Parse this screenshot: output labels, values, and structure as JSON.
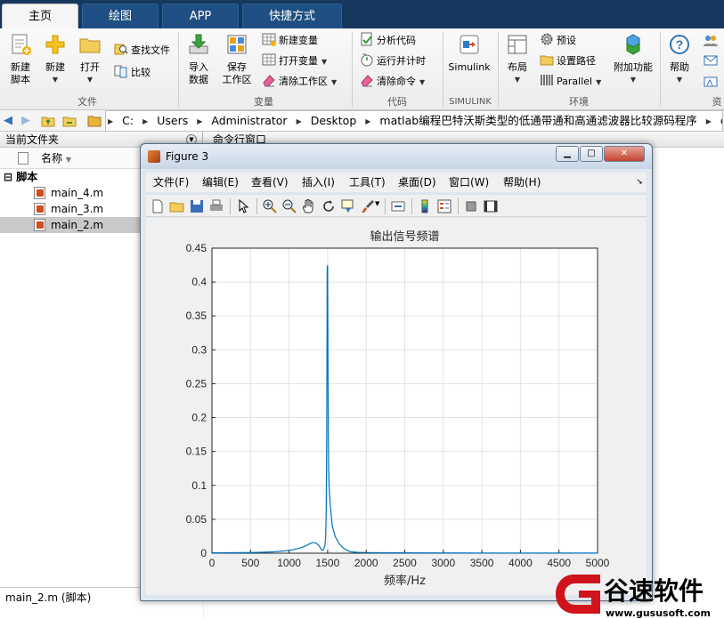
{
  "tabs": [
    {
      "label": "主页",
      "active": true
    },
    {
      "label": "绘图",
      "active": false
    },
    {
      "label": "APP",
      "active": false
    },
    {
      "label": "快捷方式",
      "active": false
    }
  ],
  "ribbon": {
    "file_group": {
      "new_script": "新建\n脚本",
      "new": "新建",
      "open": "打开",
      "find_files": "查找文件",
      "compare": "比较",
      "label": "文件"
    },
    "variable_group": {
      "import_data": "导入\n数据",
      "save_workspace": "保存\n工作区",
      "new_variable": "新建变量",
      "open_variable": "打开变量",
      "clear_workspace": "清除工作区",
      "label": "变量"
    },
    "code_group": {
      "analyze_code": "分析代码",
      "run_and_time": "运行并计时",
      "clear_commands": "清除命令",
      "label": "代码"
    },
    "simulink_group": {
      "simulink": "Simulink",
      "label": "SIMULINK"
    },
    "env_group": {
      "layout": "布局",
      "preferences": "预设",
      "set_path": "设置路径",
      "parallel": "Parallel",
      "addons": "附加功能",
      "label": "环境"
    },
    "resources_group": {
      "help": "帮助",
      "label": "资"
    }
  },
  "address": {
    "crumbs": [
      "C:",
      "Users",
      "Administrator",
      "Desktop",
      "matlab编程巴特沃斯类型的低通带通和高通滤波器比较源码程序",
      "code"
    ]
  },
  "current_folder": {
    "title": "当前文件夹",
    "col_name": "名称",
    "group": "脚本",
    "files": [
      "main_4.m",
      "main_3.m",
      "main_2.m"
    ],
    "selected": "main_2.m",
    "status": "main_2.m  (脚本)"
  },
  "command_window": {
    "title": "命令行窗口"
  },
  "figure": {
    "title": "Figure 3",
    "menu": [
      "文件(F)",
      "编辑(E)",
      "查看(V)",
      "插入(I)",
      "工具(T)",
      "桌面(D)",
      "窗口(W)",
      "帮助(H)"
    ],
    "icons": [
      "new-figure-icon",
      "open-icon",
      "save-icon",
      "print-icon",
      "pointer-icon",
      "zoom-in-icon",
      "zoom-out-icon",
      "pan-icon",
      "rotate-icon",
      "data-cursor-icon",
      "brush-icon",
      "link-icon",
      "colorbar-icon",
      "legend-icon",
      "hide-plot-tools-icon",
      "show-plot-tools-icon"
    ]
  },
  "chart_data": {
    "type": "line",
    "title": "输出信号频谱",
    "xlabel": "频率/Hz",
    "ylabel": "",
    "xlim": [
      0,
      5000
    ],
    "ylim": [
      0,
      0.45
    ],
    "xticks": [
      0,
      500,
      1000,
      1500,
      2000,
      2500,
      3000,
      3500,
      4000,
      4500,
      5000
    ],
    "yticks": [
      0,
      0.05,
      0.1,
      0.15,
      0.2,
      0.25,
      0.3,
      0.35,
      0.4,
      0.45
    ],
    "ytick_labels": [
      "0",
      "0.05",
      "0.1",
      "0.15",
      "0.2",
      "0.25",
      "0.3",
      "0.35",
      "0.4",
      "0.45"
    ],
    "grid": true,
    "color": "#0072bd",
    "series": [
      {
        "x": [
          0,
          200,
          400,
          600,
          800,
          950,
          1050,
          1150,
          1220,
          1270,
          1300,
          1330,
          1360,
          1390,
          1410,
          1430,
          1450,
          1465,
          1475,
          1482,
          1488,
          1494,
          1500,
          1506,
          1512,
          1520,
          1535,
          1560,
          1600,
          1650,
          1700,
          1750,
          1800,
          1900,
          2000,
          2200,
          2500,
          3000,
          3500,
          4000,
          4500,
          5000
        ],
        "y": [
          0.0005,
          0.0006,
          0.0008,
          0.0012,
          0.002,
          0.0035,
          0.005,
          0.008,
          0.011,
          0.014,
          0.0155,
          0.0155,
          0.014,
          0.011,
          0.007,
          0.004,
          0.006,
          0.012,
          0.025,
          0.06,
          0.18,
          0.42,
          0.425,
          0.25,
          0.14,
          0.1,
          0.07,
          0.04,
          0.024,
          0.014,
          0.008,
          0.0045,
          0.002,
          0.0012,
          0.0009,
          0.0007,
          0.0005,
          0.0004,
          0.0003,
          0.0002,
          0.0002,
          0.0001
        ]
      }
    ]
  },
  "watermark": {
    "brand": "谷速软件",
    "url": "www.gususoft.com"
  }
}
